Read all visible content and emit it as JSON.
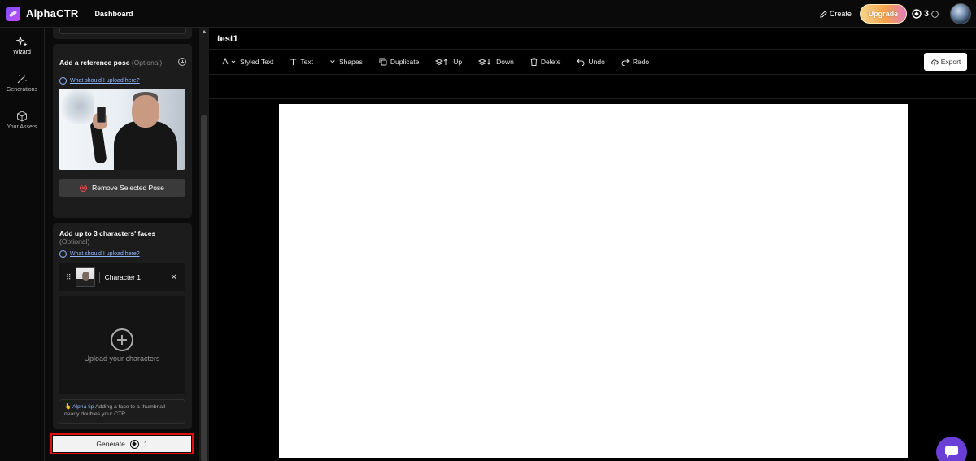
{
  "header": {
    "app_name": "AlphaCTR",
    "nav_dashboard": "Dashboard",
    "create_label": "Create",
    "upgrade_label": "Upgrade",
    "credits": "3",
    "colors": {
      "accent": "#7b4dff",
      "upgrade_gradient_start": "#f3d58c",
      "upgrade_gradient_end": "#e27cc0"
    }
  },
  "sidebar": {
    "items": [
      {
        "label": "Wizard",
        "icon": "sparkles-icon",
        "active": true
      },
      {
        "label": "Generations",
        "icon": "magic-wand-icon",
        "active": false
      },
      {
        "label": "Your Assets",
        "icon": "cube-icon",
        "active": false
      }
    ]
  },
  "wizard": {
    "pose": {
      "title": "Add a reference pose",
      "optional": "(Optional)",
      "help_link": "What should I upload here?",
      "remove_label": "Remove Selected Pose"
    },
    "faces": {
      "title": "Add up to 3 characters' faces",
      "optional": "(Optional)",
      "help_link": "What should I upload here?",
      "characters": [
        {
          "name": "Character 1"
        }
      ],
      "upload_label": "Upload your characters",
      "tip_label": "Alpha tip",
      "tip_text": "Adding a face to a thumbnail nearly doubles your CTR."
    },
    "generate": {
      "label": "Generate",
      "cost": "1",
      "highlight_color": "#e01010"
    }
  },
  "editor": {
    "doc_title": "test1",
    "toolbar": {
      "styled_text": "Styled Text",
      "text": "Text",
      "shapes": "Shapes",
      "duplicate": "Duplicate",
      "up": "Up",
      "down": "Down",
      "delete": "Delete",
      "undo": "Undo",
      "redo": "Redo",
      "export": "Export"
    }
  }
}
